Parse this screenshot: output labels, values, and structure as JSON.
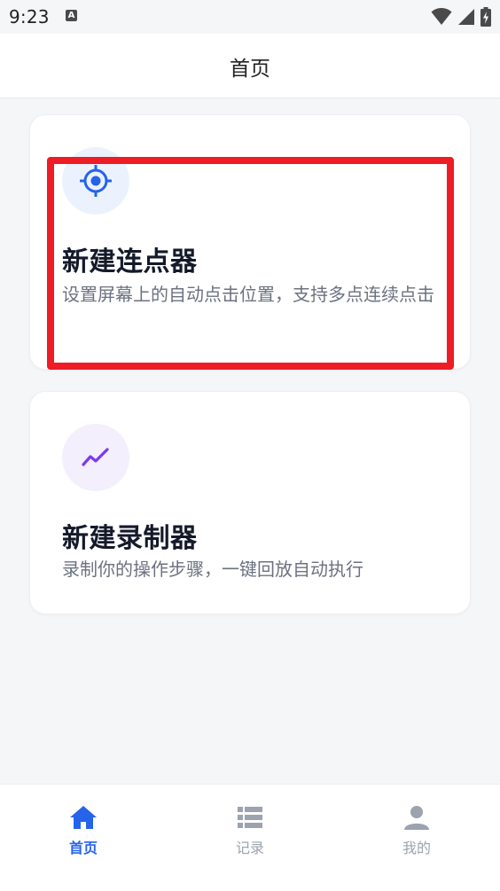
{
  "status_bar": {
    "time": "9:23",
    "notification_icon_letter": "A",
    "icons": [
      "wifi-icon",
      "signal-icon",
      "battery-charging-icon"
    ]
  },
  "header": {
    "title": "首页"
  },
  "cards": [
    {
      "icon": "crosshair-target-icon",
      "icon_color": "#2563eb",
      "icon_bg": "#ebf2fe",
      "title": "新建连点器",
      "description": "设置屏幕上的自动点击位置，支持多点连续点击"
    },
    {
      "icon": "trend-line-icon",
      "icon_color": "#7c3aed",
      "icon_bg": "#f3effd",
      "title": "新建录制器",
      "description": "录制你的操作步骤，一键回放自动执行"
    }
  ],
  "highlight": {
    "color": "#ee1c25",
    "target": "card-0"
  },
  "bottom_nav": {
    "active": 0,
    "active_color": "#2563eb",
    "inactive_color": "#9ca3af",
    "items": [
      {
        "label": "首页",
        "icon": "home-icon"
      },
      {
        "label": "记录",
        "icon": "list-icon"
      },
      {
        "label": "我的",
        "icon": "user-icon"
      }
    ]
  }
}
